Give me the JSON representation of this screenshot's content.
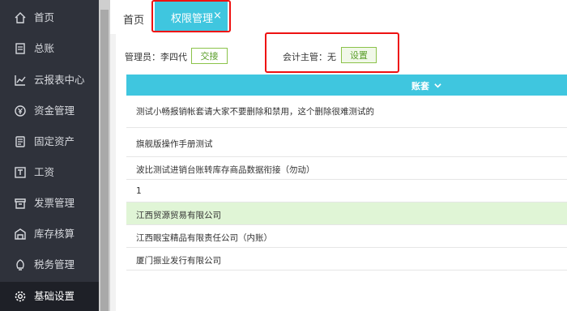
{
  "sidebar": {
    "items": [
      {
        "label": "首页",
        "icon": "home-icon"
      },
      {
        "label": "总账",
        "icon": "ledger-icon"
      },
      {
        "label": "云报表中心",
        "icon": "chart-icon"
      },
      {
        "label": "资金管理",
        "icon": "money-icon"
      },
      {
        "label": "固定资产",
        "icon": "asset-icon"
      },
      {
        "label": "工资",
        "icon": "salary-icon"
      },
      {
        "label": "发票管理",
        "icon": "invoice-icon"
      },
      {
        "label": "库存核算",
        "icon": "warehouse-icon"
      },
      {
        "label": "税务管理",
        "icon": "tax-icon"
      },
      {
        "label": "基础设置",
        "icon": "gear-icon"
      }
    ]
  },
  "tabs": {
    "home": "首页",
    "active": "权限管理",
    "close": "×"
  },
  "toolbar": {
    "admin_label": "管理员：李四代",
    "handover_button": "交接",
    "accountant_label": "会计主管：无",
    "set_button": "设置"
  },
  "table": {
    "header": "账套",
    "rows": [
      "测试小畅报销帐套请大家不要删除和禁用，这个删除很难测试的",
      "旗舰版操作手册测试",
      "波比测试进销台账转库存商品数据衔接（勿动）",
      "1",
      "江西贸源贸易有限公司",
      "江西眼宝精品有限责任公司（内账）",
      "厦门振业发行有限公司"
    ],
    "highlighted_row": 4
  },
  "colors": {
    "sidebar_bg": "#2f323b",
    "accent": "#3fc6df",
    "button_green": "#8bc34a",
    "highlight_row": "#e0f5d6",
    "annotation_red": "#e11111"
  }
}
